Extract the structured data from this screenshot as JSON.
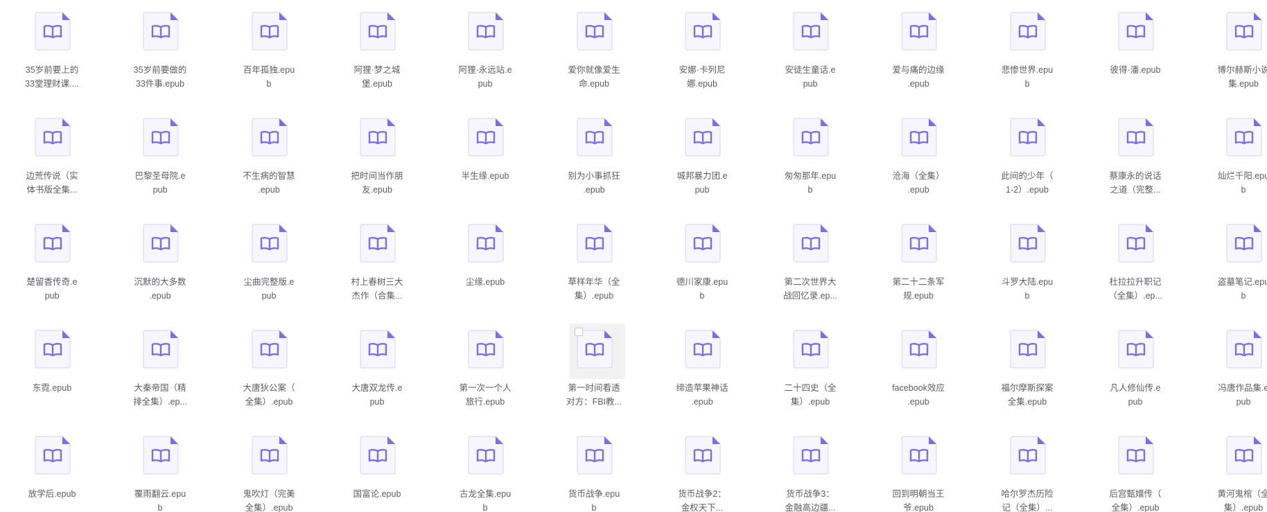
{
  "colors": {
    "icon_stroke": "#7b6ee8",
    "icon_fill": "#f7f6ff",
    "icon_border": "#dcd8f7",
    "label": "#5c5c66"
  },
  "icons": {
    "file": "epub-book-file-icon"
  },
  "files": [
    {
      "lines": [
        "35岁前要上的",
        "33堂理财课...."
      ]
    },
    {
      "lines": [
        "35岁前要做的",
        "33件事.epub"
      ]
    },
    {
      "lines": [
        "百年孤独.epu",
        "b"
      ]
    },
    {
      "lines": [
        "阿狸·梦之城",
        "堡.epub"
      ]
    },
    {
      "lines": [
        "阿狸·永远站.e",
        "pub"
      ]
    },
    {
      "lines": [
        "爱你就像爱生",
        "命.epub"
      ]
    },
    {
      "lines": [
        "安娜·卡列尼",
        "娜.epub"
      ]
    },
    {
      "lines": [
        "安徒生童话.e",
        "pub"
      ]
    },
    {
      "lines": [
        "爱与痛的边缘",
        ".epub"
      ]
    },
    {
      "lines": [
        "悲惨世界.epu",
        "b"
      ]
    },
    {
      "lines": [
        "彼得·潘.epub"
      ]
    },
    {
      "lines": [
        "博尔赫斯小说",
        "集.epub"
      ]
    },
    {
      "lines": [
        "边荒传说（实",
        "体书版全集..."
      ]
    },
    {
      "lines": [
        "巴黎圣母院.e",
        "pub"
      ]
    },
    {
      "lines": [
        "不生病的智慧",
        ".epub"
      ]
    },
    {
      "lines": [
        "把时间当作朋",
        "友.epub"
      ]
    },
    {
      "lines": [
        "半生缘.epub"
      ]
    },
    {
      "lines": [
        "别为小事抓狂",
        ".epub"
      ]
    },
    {
      "lines": [
        "城邦暴力团.e",
        "pub"
      ]
    },
    {
      "lines": [
        "匆匆那年.epu",
        "b"
      ]
    },
    {
      "lines": [
        "沧海（全集）",
        ".epub"
      ]
    },
    {
      "lines": [
        "此间的少年（",
        "1-2）.epub"
      ]
    },
    {
      "lines": [
        "蔡康永的说话",
        "之道（完整..."
      ]
    },
    {
      "lines": [
        "灿烂千阳.epu",
        "b"
      ]
    },
    {
      "lines": [
        "楚留香传奇.e",
        "pub"
      ]
    },
    {
      "lines": [
        "沉默的大多数",
        ".epub"
      ]
    },
    {
      "lines": [
        "尘曲完整版.e",
        "pub"
      ]
    },
    {
      "lines": [
        "村上春树三大",
        "杰作（合集..."
      ]
    },
    {
      "lines": [
        "尘缘.epub"
      ]
    },
    {
      "lines": [
        "草样年华（全",
        "集）.epub"
      ]
    },
    {
      "lines": [
        "德川家康.epu",
        "b"
      ]
    },
    {
      "lines": [
        "第二次世界大",
        "战回忆录.ep..."
      ]
    },
    {
      "lines": [
        "第二十二条军",
        "规.epub"
      ]
    },
    {
      "lines": [
        "斗罗大陆.epu",
        "b"
      ]
    },
    {
      "lines": [
        "杜拉拉升职记",
        "（全集）.ep..."
      ]
    },
    {
      "lines": [
        "盗墓笔记.epu",
        "b"
      ]
    },
    {
      "lines": [
        "东霓.epub"
      ]
    },
    {
      "lines": [
        "大秦帝国（精",
        "排全集）.ep..."
      ]
    },
    {
      "lines": [
        "大唐狄公案（",
        "全集）.epub"
      ]
    },
    {
      "lines": [
        "大唐双龙传.e",
        "pub"
      ]
    },
    {
      "lines": [
        "第一次一个人",
        "旅行.epub"
      ]
    },
    {
      "lines": [
        "第一时间看透",
        "对方：FBI教..."
      ],
      "hovered": true
    },
    {
      "lines": [
        "缔造苹果神话",
        ".epub"
      ]
    },
    {
      "lines": [
        "二十四史（全",
        "集）.epub"
      ]
    },
    {
      "lines": [
        "facebook效应",
        ".epub"
      ]
    },
    {
      "lines": [
        "福尔摩斯探案",
        "全集.epub"
      ]
    },
    {
      "lines": [
        "凡人修仙传.e",
        "pub"
      ]
    },
    {
      "lines": [
        "冯唐作品集.e",
        "pub"
      ]
    },
    {
      "lines": [
        "放学后.epub"
      ]
    },
    {
      "lines": [
        "覆雨翻云.epu",
        "b"
      ]
    },
    {
      "lines": [
        "鬼吹灯（完美",
        "全集）.epub"
      ]
    },
    {
      "lines": [
        "国富论.epub"
      ]
    },
    {
      "lines": [
        "古龙全集.epu",
        "b"
      ]
    },
    {
      "lines": [
        "货币战争.epu",
        "b"
      ]
    },
    {
      "lines": [
        "货币战争2：",
        "金权天下..."
      ]
    },
    {
      "lines": [
        "货币战争3：",
        "金融高边疆..."
      ]
    },
    {
      "lines": [
        "回到明朝当王",
        "爷.epub"
      ]
    },
    {
      "lines": [
        "哈尔罗杰历险",
        "记（全集）..."
      ]
    },
    {
      "lines": [
        "后宫甄嬛传（",
        "全集）.epub"
      ]
    },
    {
      "lines": [
        "黄河鬼棺（全",
        "集）.epub"
      ]
    }
  ]
}
